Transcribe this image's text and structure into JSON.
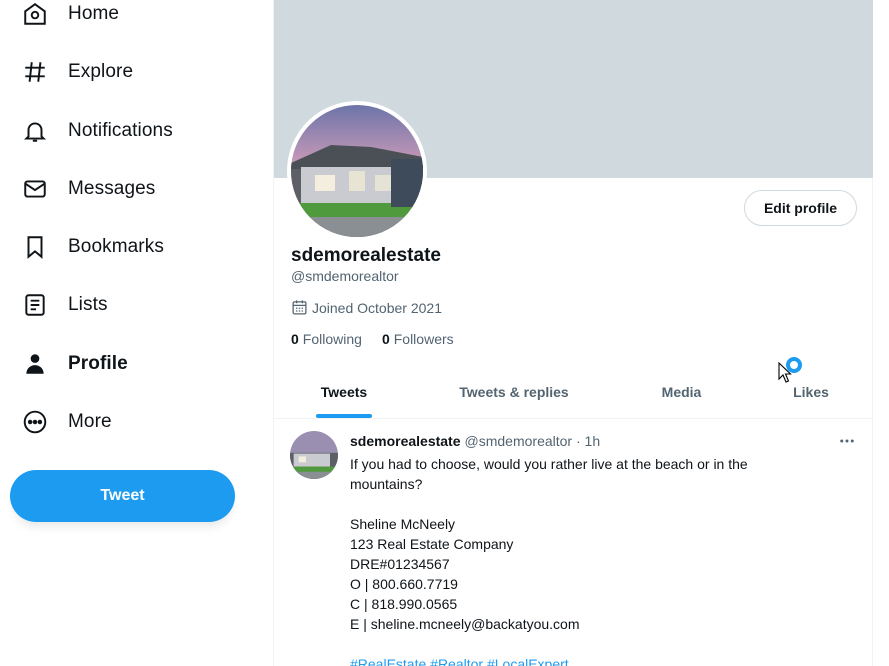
{
  "sidebar": {
    "items": [
      {
        "label": "Home",
        "icon": "home-icon"
      },
      {
        "label": "Explore",
        "icon": "hashtag-icon"
      },
      {
        "label": "Notifications",
        "icon": "bell-icon"
      },
      {
        "label": "Messages",
        "icon": "envelope-icon"
      },
      {
        "label": "Bookmarks",
        "icon": "bookmark-icon"
      },
      {
        "label": "Lists",
        "icon": "list-icon"
      },
      {
        "label": "Profile",
        "icon": "person-icon",
        "active": true
      },
      {
        "label": "More",
        "icon": "more-circle-icon"
      }
    ],
    "tweet_button": "Tweet"
  },
  "profile": {
    "display_name": "sdemorealestate",
    "handle": "@smdemorealtor",
    "joined": "Joined October 2021",
    "following_count": "0",
    "following_label": "Following",
    "followers_count": "0",
    "followers_label": "Followers",
    "edit_button": "Edit profile"
  },
  "tabs": [
    {
      "label": "Tweets",
      "active": true
    },
    {
      "label": "Tweets & replies"
    },
    {
      "label": "Media"
    },
    {
      "label": "Likes"
    }
  ],
  "tweet": {
    "name": "sdemorealestate",
    "meta": "@smdemorealtor · 1h",
    "lines": [
      "If you had to choose, would you rather live at the beach or in the mountains?",
      "",
      "Sheline McNeely",
      "123 Real Estate Company",
      "DRE#01234567",
      "O | 800.660.7719",
      "C | 818.990.0565",
      "E | sheline.mcneely@backatyou.com",
      ""
    ],
    "hashtags": "#RealEstate #Realtor #LocalExpert"
  },
  "colors": {
    "accent": "#1d9bf0",
    "banner": "#cfd9de",
    "text": "#0f1419",
    "secondary": "#536471"
  }
}
